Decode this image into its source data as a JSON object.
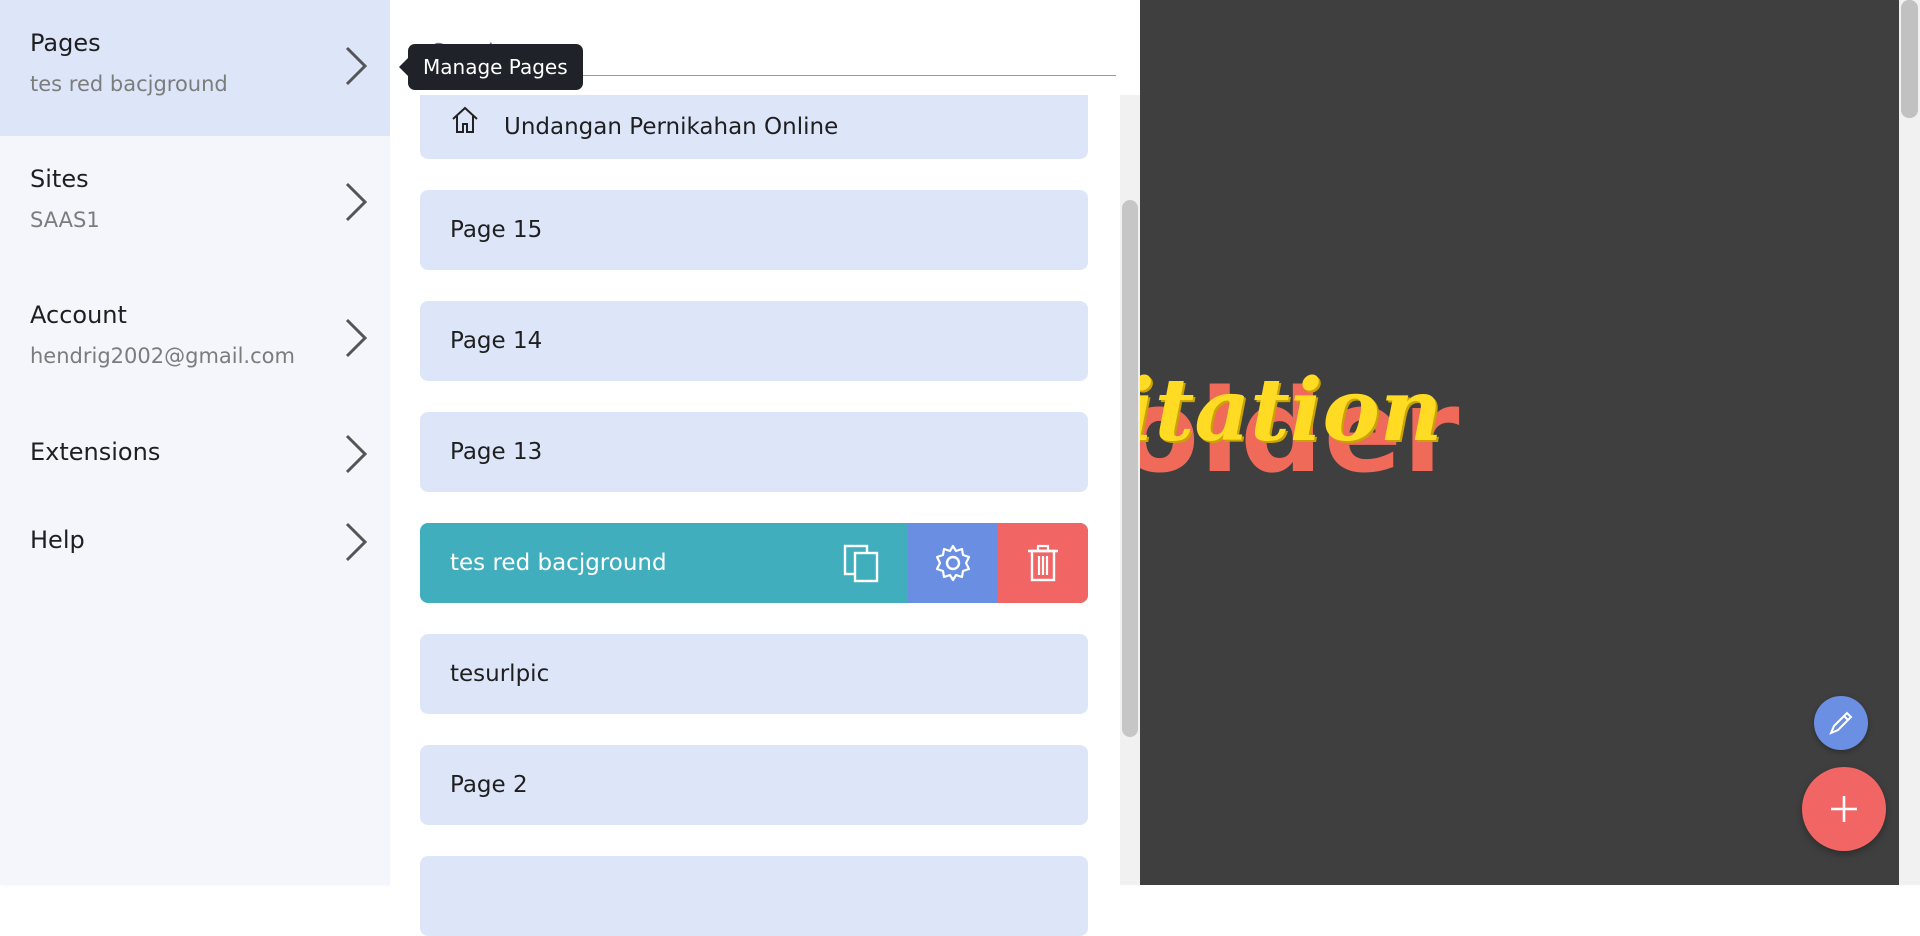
{
  "nav": {
    "items": [
      {
        "title": "Pages",
        "subtitle": "tes red bacjground"
      },
      {
        "title": "Sites",
        "subtitle": "SAAS1"
      },
      {
        "title": "Account",
        "subtitle": "hendrig2002@gmail.com"
      },
      {
        "title": "Extensions"
      },
      {
        "title": "Help"
      }
    ]
  },
  "tooltip": "Manage Pages",
  "search": {
    "placeholder": "Search"
  },
  "pages": {
    "items": [
      {
        "label": "Undangan Pernikahan Online",
        "icon": "home-icon",
        "is_home": true
      },
      {
        "label": "Page 15"
      },
      {
        "label": "Page 14"
      },
      {
        "label": "Page 13"
      },
      {
        "label": "tes red bacjground",
        "selected": true
      },
      {
        "label": "tesurlpic"
      },
      {
        "label": "Page 2"
      },
      {
        "label": ""
      }
    ],
    "row_actions": [
      "duplicate-icon",
      "settings-icon",
      "delete-icon"
    ]
  },
  "canvas": {
    "back_text": "older",
    "front_text": "itation"
  },
  "colors": {
    "accent_selected": "#40aebc",
    "settings_action": "#6a8fe2",
    "delete_action": "#f26565",
    "row_bg": "#dde6f9",
    "canvas_bg": "#3f3f3f"
  }
}
